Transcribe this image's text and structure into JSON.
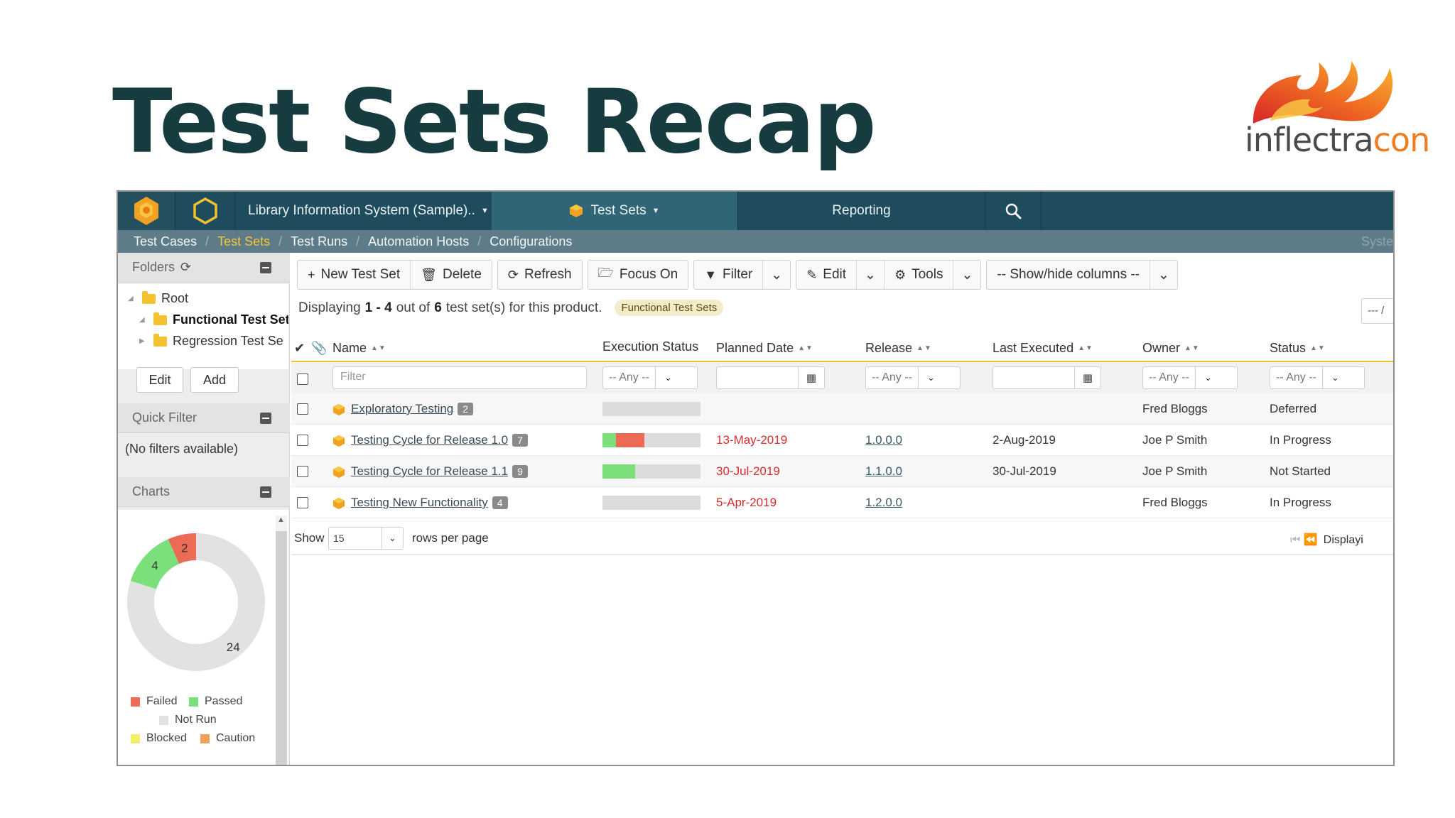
{
  "slide": {
    "title": "Test Sets Recap",
    "logo_text_main": "inflectra",
    "logo_text_accent": "con"
  },
  "topnav": {
    "product": "Library Information System (Sample)..",
    "active_tab": "Test Sets",
    "reporting": "Reporting"
  },
  "subnav": {
    "items": [
      "Test Cases",
      "Test Sets",
      "Test Runs",
      "Automation Hosts",
      "Configurations"
    ],
    "active": "Test Sets",
    "right_cut": "Syster"
  },
  "leftpanel": {
    "folders_title": "Folders",
    "tree": [
      "Root",
      "Functional Test Set",
      "Regression Test Se"
    ],
    "edit_label": "Edit",
    "add_label": "Add",
    "quick_filter_title": "Quick Filter",
    "no_filters": "(No filters available)",
    "charts_title": "Charts",
    "donut": {
      "values": [
        {
          "label": "Failed",
          "value": 2,
          "color": "#ec6b56"
        },
        {
          "label": "Passed",
          "value": 4,
          "color": "#7be07b"
        },
        {
          "label": "Not Run",
          "value": 24,
          "color": "#e2e2e2"
        }
      ],
      "labels": [
        "2",
        "4",
        "24"
      ]
    },
    "legend": [
      {
        "label": "Failed",
        "color": "#ec6b56"
      },
      {
        "label": "Passed",
        "color": "#7be07b"
      },
      {
        "label": "Not Run",
        "color": "#e2e2e2"
      },
      {
        "label": "Blocked",
        "color": "#f4ee6a"
      },
      {
        "label": "Caution",
        "color": "#f2a25a"
      }
    ]
  },
  "toolbar": {
    "new_label": "New Test Set",
    "delete_label": "Delete",
    "refresh_label": "Refresh",
    "focus_label": "Focus On",
    "filter_label": "Filter",
    "edit_label": "Edit",
    "tools_label": "Tools",
    "columns_label": "-- Show/hide columns --"
  },
  "summary": {
    "prefix": "Displaying",
    "range": "1 - 4",
    "mid": "out of",
    "total": "6",
    "suffix": "test set(s) for this product.",
    "pill": "Functional Test Sets",
    "right_btn": "--- /"
  },
  "table": {
    "headers": {
      "name": "Name",
      "exec": "Execution Status",
      "planned": "Planned Date",
      "release": "Release",
      "last": "Last Executed",
      "owner": "Owner",
      "status": "Status"
    },
    "filter_placeholder": "Filter",
    "any": "-- Any --",
    "rows": [
      {
        "name": "Exploratory Testing",
        "count": "2",
        "passed": 0,
        "failed": 0,
        "planned": "",
        "release": "",
        "last": "",
        "owner": "Fred Bloggs",
        "status": "Deferred"
      },
      {
        "name": "Testing Cycle for Release 1.0",
        "count": "7",
        "passed": 0.14,
        "failed": 0.29,
        "planned": "13-May-2019",
        "release": "1.0.0.0",
        "last": "2-Aug-2019",
        "owner": "Joe P Smith",
        "status": "In Progress"
      },
      {
        "name": "Testing Cycle for Release 1.1",
        "count": "9",
        "passed": 0.33,
        "failed": 0,
        "planned": "30-Jul-2019",
        "release": "1.1.0.0",
        "last": "30-Jul-2019",
        "owner": "Joe P Smith",
        "status": "Not Started"
      },
      {
        "name": "Testing New Functionality",
        "count": "4",
        "passed": 0,
        "failed": 0,
        "planned": "5-Apr-2019",
        "release": "1.2.0.0",
        "last": "",
        "owner": "Fred Bloggs",
        "status": "In Progress"
      }
    ]
  },
  "pager": {
    "show": "Show",
    "page_size": "15",
    "rows_per_page": "rows per page",
    "right": "Displayi"
  }
}
